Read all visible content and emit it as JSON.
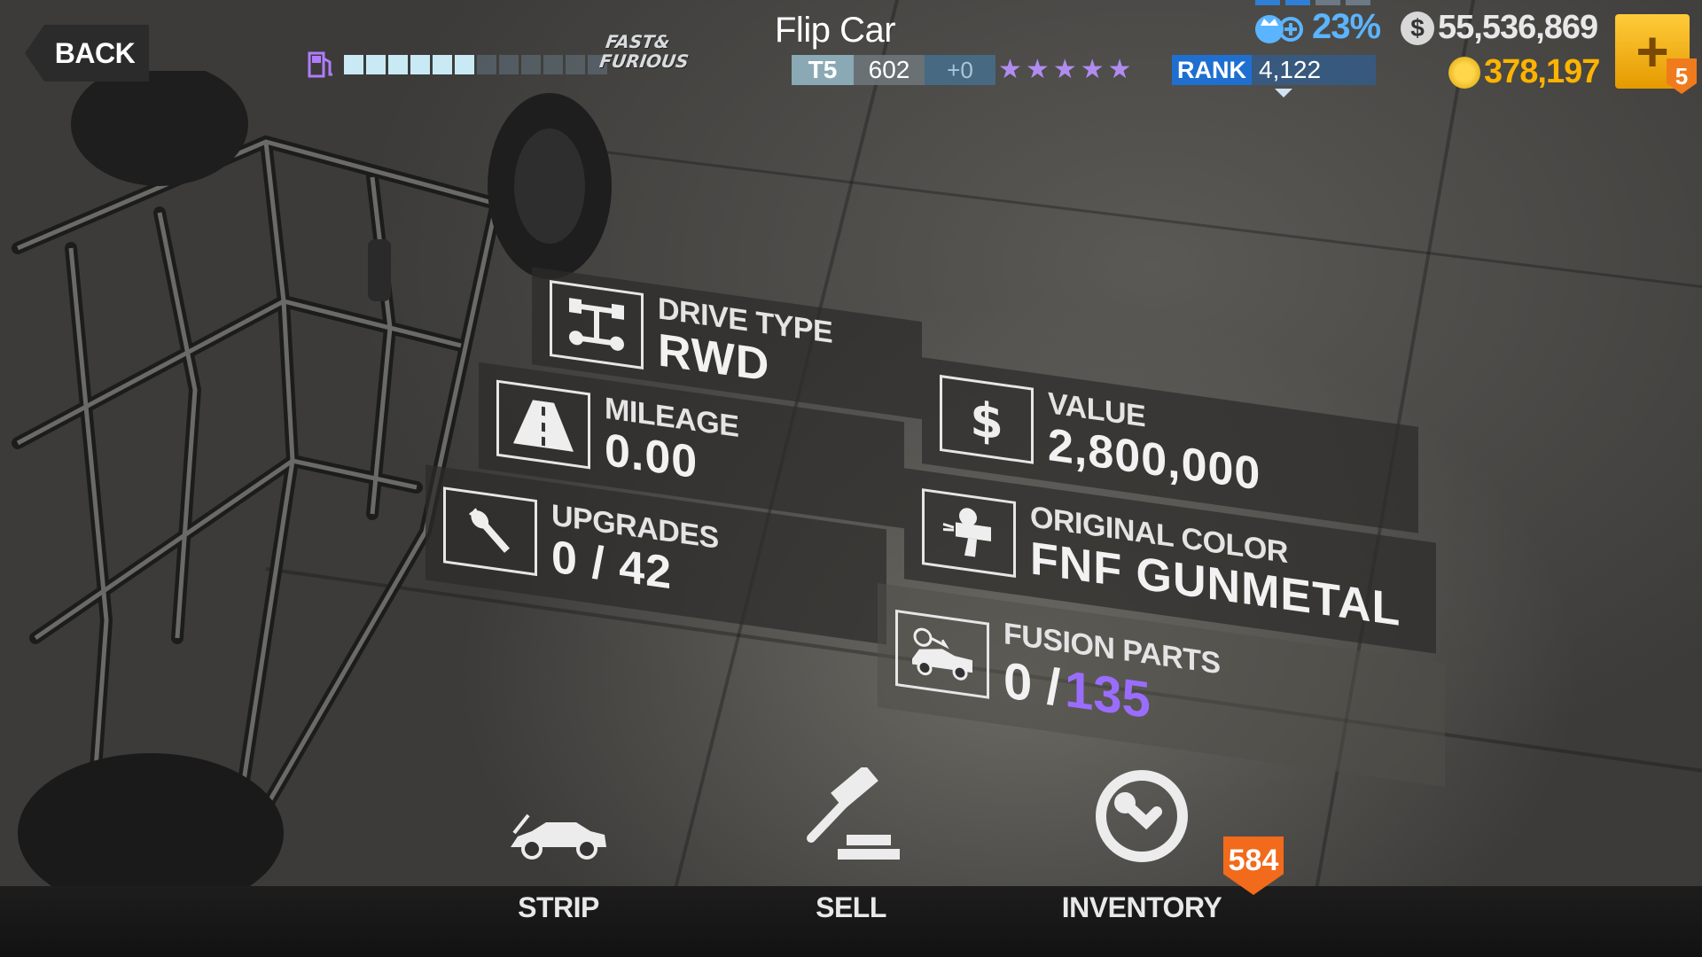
{
  "header": {
    "back_label": "BACK",
    "brand_logo": "FAST & FURIOUS",
    "car_name": "Flip Car",
    "fuel": {
      "filled": 6,
      "total": 12
    },
    "tier": "T5",
    "pp": "602",
    "pp_delta": "+0",
    "stars": 5,
    "rank_label": "RANK",
    "rank_value": "4,122",
    "crew_percent": "23%",
    "cash": "55,536,869",
    "gold": "378,197",
    "notification_count": "5"
  },
  "stats": {
    "drive_type": {
      "label": "DRIVE TYPE",
      "value": "RWD"
    },
    "mileage": {
      "label": "MILEAGE",
      "value": "0.00"
    },
    "upgrades": {
      "label": "UPGRADES",
      "value": "0 / 42"
    },
    "car_value": {
      "label": "VALUE",
      "value": "2,800,000"
    },
    "original_color": {
      "label": "ORIGINAL COLOR",
      "value": "FNF GUNMETAL"
    },
    "fusion_parts": {
      "label": "FUSION PARTS",
      "current": "0 /",
      "total": "135"
    }
  },
  "actions": {
    "strip": "STRIP",
    "sell": "SELL",
    "inventory": "INVENTORY",
    "inventory_count": "584"
  },
  "colors": {
    "tier": "#8aa9b5",
    "rank": "#1f6fd1",
    "crew": "#5bb4ff",
    "gold": "#ffb300",
    "fusion": "#9a6dff",
    "badge": "#f26a1b"
  }
}
